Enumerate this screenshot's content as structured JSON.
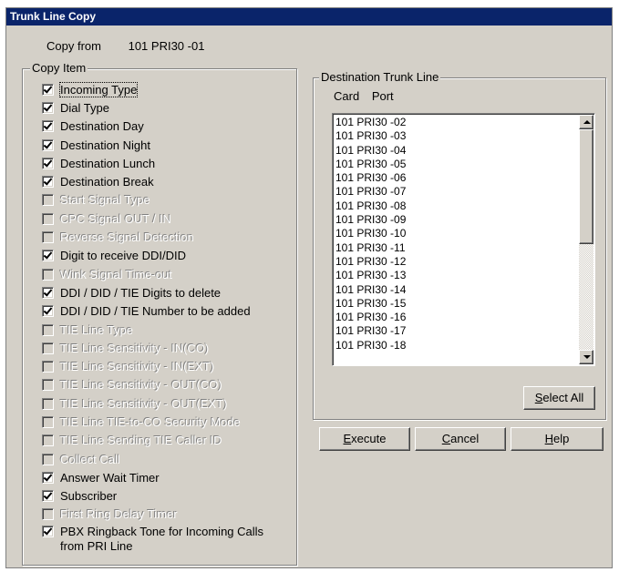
{
  "window": {
    "title": "Trunk Line Copy"
  },
  "copy_from": {
    "label": "Copy from",
    "value": "101 PRI30 -01"
  },
  "copy_item": {
    "label": "Copy Item",
    "items": [
      {
        "label": "Incoming Type",
        "checked": true,
        "enabled": true,
        "focused": true
      },
      {
        "label": "Dial Type",
        "checked": true,
        "enabled": true
      },
      {
        "label": "Destination Day",
        "checked": true,
        "enabled": true
      },
      {
        "label": "Destination Night",
        "checked": true,
        "enabled": true
      },
      {
        "label": "Destination Lunch",
        "checked": true,
        "enabled": true
      },
      {
        "label": "Destination Break",
        "checked": true,
        "enabled": true
      },
      {
        "label": "Start Signal Type",
        "checked": false,
        "enabled": false
      },
      {
        "label": "CPC Signal OUT / IN",
        "checked": false,
        "enabled": false
      },
      {
        "label": "Reverse Signal Detection",
        "checked": false,
        "enabled": false
      },
      {
        "label": "Digit to receive DDI/DID",
        "checked": true,
        "enabled": true
      },
      {
        "label": "Wink Signal Time-out",
        "checked": false,
        "enabled": false
      },
      {
        "label": "DDI / DID / TIE Digits to delete",
        "checked": true,
        "enabled": true
      },
      {
        "label": "DDI / DID / TIE Number to be added",
        "checked": true,
        "enabled": true
      },
      {
        "label": "TIE Line Type",
        "checked": false,
        "enabled": false
      },
      {
        "label": "TIE Line Sensitivity - IN(CO)",
        "checked": false,
        "enabled": false
      },
      {
        "label": "TIE Line Sensitivity - IN(EXT)",
        "checked": false,
        "enabled": false
      },
      {
        "label": "TIE Line Sensitivity - OUT(CO)",
        "checked": false,
        "enabled": false
      },
      {
        "label": "TIE Line Sensitivity - OUT(EXT)",
        "checked": false,
        "enabled": false
      },
      {
        "label": "TIE Line TIE-to-CO Security Mode",
        "checked": false,
        "enabled": false
      },
      {
        "label": "TIE Line Sending TIE Caller ID",
        "checked": false,
        "enabled": false
      },
      {
        "label": "Collect Call",
        "checked": false,
        "enabled": false
      },
      {
        "label": "Answer Wait Timer",
        "checked": true,
        "enabled": true
      },
      {
        "label": "Subscriber",
        "checked": true,
        "enabled": true
      },
      {
        "label": "First Ring Delay Timer",
        "checked": false,
        "enabled": false
      },
      {
        "label": "PBX Ringback Tone for Incoming Calls from PRI Line",
        "checked": true,
        "enabled": true,
        "tall": true
      }
    ]
  },
  "destination": {
    "label": "Destination Trunk Line",
    "col_card": "Card",
    "col_port": "Port",
    "lines": [
      "101 PRI30 -02",
      "101 PRI30 -03",
      "101 PRI30 -04",
      "101 PRI30 -05",
      "101 PRI30 -06",
      "101 PRI30 -07",
      "101 PRI30 -08",
      "101 PRI30 -09",
      "101 PRI30 -10",
      "101 PRI30 -11",
      "101 PRI30 -12",
      "101 PRI30 -13",
      "101 PRI30 -14",
      "101 PRI30 -15",
      "101 PRI30 -16",
      "101 PRI30 -17",
      "101 PRI30 -18"
    ],
    "select_all": {
      "mnemonic": "S",
      "rest": "elect All"
    }
  },
  "buttons": {
    "execute": {
      "mnemonic": "E",
      "rest": "xecute"
    },
    "cancel": {
      "mnemonic": "C",
      "rest": "ancel"
    },
    "help": {
      "mnemonic": "H",
      "rest": "elp"
    }
  },
  "colors": {
    "titlebar": "#0a246a",
    "face": "#d4d0c8",
    "disabled_text": "#ffffff"
  }
}
